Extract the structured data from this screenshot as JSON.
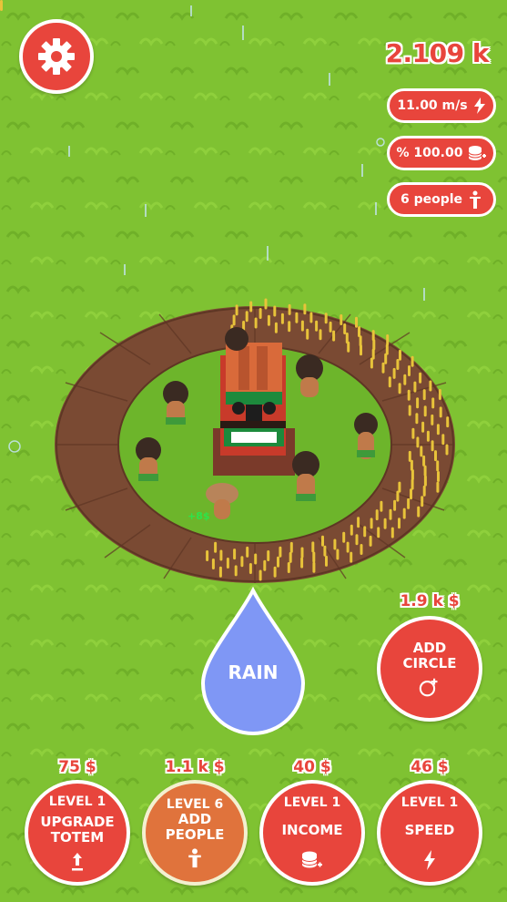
{
  "hud": {
    "money": "2.109 k",
    "speed": "11.00 m/s",
    "percent": "% 100.00",
    "people": "6 people"
  },
  "floating_text": "+8$",
  "rain_button": {
    "label": "RAIN"
  },
  "add_circle": {
    "price": "1.9 k $",
    "line1": "ADD",
    "line2": "CIRCLE"
  },
  "upgrades": [
    {
      "price": "75 $",
      "level": "LEVEL 1",
      "line1": "UPGRADE",
      "line2": "TOTEM",
      "icon": "arrow-up-icon"
    },
    {
      "price": "1.1 k $",
      "level": "LEVEL 6",
      "line1": "ADD",
      "line2": "PEOPLE",
      "icon": "person-icon"
    },
    {
      "price": "40 $",
      "level": "LEVEL 1",
      "line1": "INCOME",
      "line2": "",
      "icon": "coins-icon"
    },
    {
      "price": "46 $",
      "level": "LEVEL 1",
      "line1": "SPEED",
      "line2": "",
      "icon": "lightning-icon"
    }
  ],
  "colors": {
    "accent": "#e8453c",
    "accent_orange": "#e0733c",
    "grass": "#7fc232",
    "rain_drop": "#7f97f5"
  }
}
